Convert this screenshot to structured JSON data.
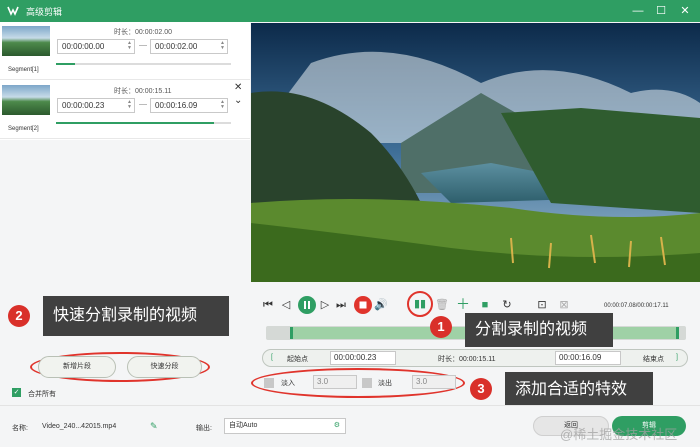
{
  "window": {
    "title": "高级剪辑"
  },
  "segments": [
    {
      "label": "Segment[1]",
      "duration_label": "时长：00:00:02.00",
      "start": "00:00:00.00",
      "end": "00:00:02.00",
      "progress": 0.11
    },
    {
      "label": "Segment[2]",
      "duration_label": "时长：00:00:15.11",
      "start": "00:00:00.23",
      "end": "00:00:16.09",
      "progress": 0.9
    }
  ],
  "annotations": {
    "a1": {
      "number": "1",
      "text": "分割录制的视频"
    },
    "a2": {
      "number": "2",
      "text": "快速分割录制的视频"
    },
    "a3": {
      "number": "3",
      "text": "添加合适的特效"
    }
  },
  "left_buttons": {
    "add_segment": "新增片段",
    "quick_split": "快速分段"
  },
  "merge": {
    "label": "合并所有",
    "checked": true
  },
  "player": {
    "time_display": "00:00:07.08/00:00:17.11"
  },
  "range": {
    "start_label": "起始点",
    "start_value": "00:00:00.23",
    "duration_label": "时长：00:00:15.11",
    "end_value": "00:00:16.09",
    "end_label": "结束点"
  },
  "effects": {
    "fade_in_label": "淡入",
    "fade_in_value": "3.0",
    "fade_out_label": "淡出",
    "fade_out_value": "3.0"
  },
  "bottom": {
    "name_label": "名称:",
    "file_name": "Video_240...42015.mp4",
    "output_label": "输出:",
    "output_value": "自动Auto",
    "back_button": "返回",
    "clip_button": "剪辑"
  },
  "watermark": "@稀土掘金技术社区",
  "colors": {
    "brand": "#2f9e63",
    "annotation_red": "#e0342c",
    "callout_bg": "#404040"
  }
}
